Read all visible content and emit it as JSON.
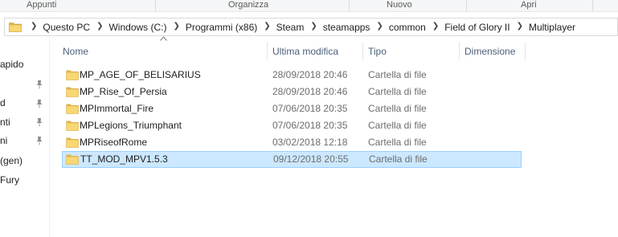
{
  "ribbon": {
    "groups": [
      "Appunti",
      "Organizza",
      "Nuovo",
      "Apri"
    ]
  },
  "address": {
    "breadcrumbs": [
      "Questo PC",
      "Windows (C:)",
      "Programmi (x86)",
      "Steam",
      "steamapps",
      "common",
      "Field of Glory II",
      "Multiplayer"
    ]
  },
  "nav": {
    "items": [
      "apido",
      "",
      "d",
      "nti",
      "ni",
      "(gen)",
      "Fury"
    ]
  },
  "columns": {
    "name": "Nome",
    "modified": "Ultima modifica",
    "type": "Tipo",
    "size": "Dimensione"
  },
  "files": [
    {
      "name": "MP_AGE_OF_BELISARIUS",
      "modified": "28/09/2018 20:46",
      "type": "Cartella di file",
      "selected": false
    },
    {
      "name": "MP_Rise_Of_Persia",
      "modified": "28/09/2018 20:46",
      "type": "Cartella di file",
      "selected": false
    },
    {
      "name": "MPImmortal_Fire",
      "modified": "07/06/2018 20:35",
      "type": "Cartella di file",
      "selected": false
    },
    {
      "name": "MPLegions_Triumphant",
      "modified": "07/06/2018 20:35",
      "type": "Cartella di file",
      "selected": false
    },
    {
      "name": "MPRiseofRome",
      "modified": "03/02/2018 12:18",
      "type": "Cartella di file",
      "selected": false
    },
    {
      "name": "TT_MOD_MPV1.5.3",
      "modified": "09/12/2018 20:55",
      "type": "Cartella di file",
      "selected": true
    }
  ],
  "colors": {
    "folder": "#f8d775",
    "folder_dark": "#e0b34a",
    "selection": "#cce8ff",
    "selection_border": "#99d1ff",
    "header_text": "#4c607a"
  }
}
